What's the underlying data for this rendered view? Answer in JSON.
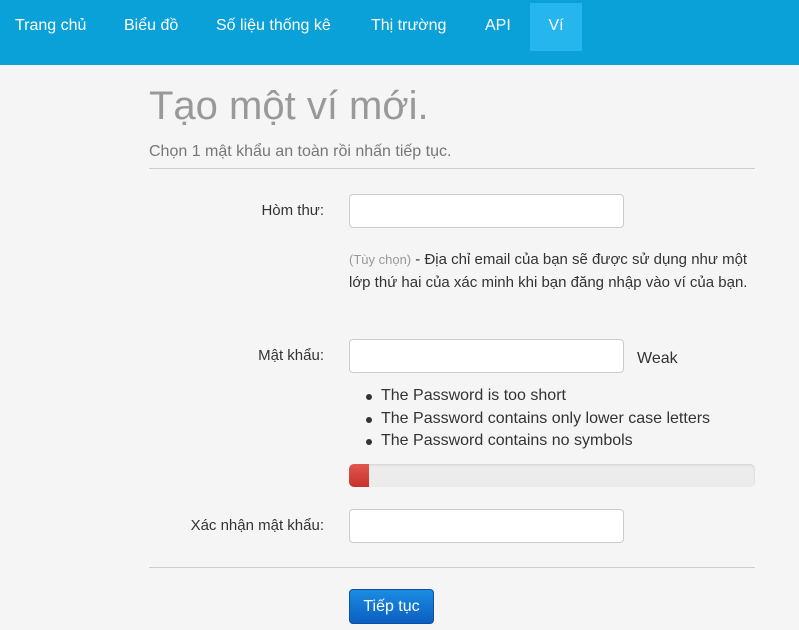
{
  "nav": {
    "items": [
      {
        "label": "Trang chủ"
      },
      {
        "label": "Biểu đồ"
      },
      {
        "label": "Số liệu thống kê"
      },
      {
        "label": "Thị trường"
      },
      {
        "label": "API"
      },
      {
        "label": "Ví",
        "active": true
      }
    ],
    "bg_color": "#0aa0d8",
    "active_color": "#25b6ee"
  },
  "header": {
    "title": "Tạo một ví mới.",
    "subtitle": "Chọn 1 mật khẩu an toàn rồi nhấn tiếp tục."
  },
  "form": {
    "email": {
      "label": "Hòm thư:",
      "value": "",
      "help_optional": "(Tùy chọn)",
      "help_text": " - Địa chỉ email của bạn sẽ được sử dụng như một lớp thứ hai của xác minh khi bạn đăng nhập vào ví của bạn."
    },
    "password": {
      "label": "Mật khẩu:",
      "value": "",
      "strength_label": "Weak",
      "issues": [
        "The Password is too short",
        "The Password contains only lower case letters",
        "The Password contains no symbols"
      ],
      "strength_fraction": 0.05,
      "strength_color": "#d9534f"
    },
    "confirm": {
      "label": "Xác nhận mật khẩu:",
      "value": ""
    },
    "submit_label": "Tiếp tục"
  }
}
